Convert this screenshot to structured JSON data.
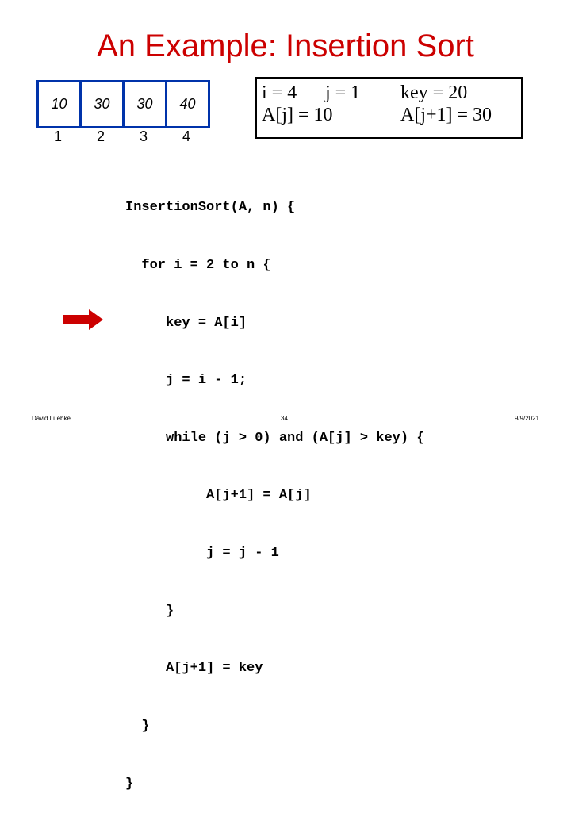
{
  "slide": {
    "title": "An Example: Insertion Sort",
    "array": {
      "values": [
        "10",
        "30",
        "30",
        "40"
      ],
      "indices": [
        "1",
        "2",
        "3",
        "4"
      ]
    },
    "state": {
      "i": "i = 4",
      "j": "j = 1",
      "key": "key = 20",
      "aj": "A[j] = 10",
      "aj1": "A[j+1] = 30"
    },
    "code_lines": [
      "InsertionSort(A, n) {",
      "  for i = 2 to n {",
      "     key = A[i]",
      "     j = i - 1;",
      "     while (j > 0) and (A[j] > key) {",
      "          A[j+1] = A[j]",
      "          j = j - 1",
      "     }",
      "     A[j+1] = key",
      "  }",
      "}"
    ],
    "current_line_index": 8,
    "arrow_color": "#cc0000",
    "footer": {
      "author": "David Luebke",
      "page": "34",
      "date": "9/9/2021"
    }
  }
}
